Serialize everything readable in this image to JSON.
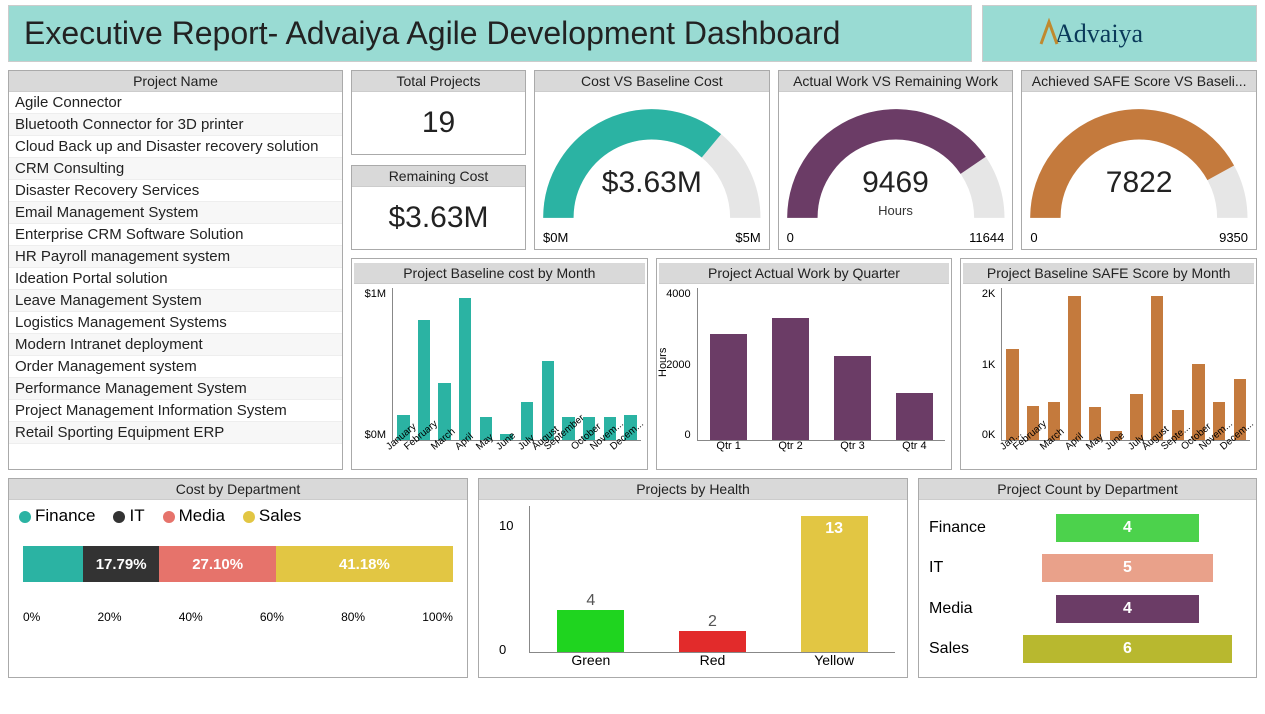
{
  "header": {
    "title": "Executive Report- Advaiya Agile Development Dashboard",
    "logo_text": "Advaiya"
  },
  "project_list": {
    "title": "Project Name",
    "items": [
      "Agile Connector",
      "Bluetooth Connector for 3D printer",
      "Cloud Back up and Disaster recovery solution",
      "CRM Consulting",
      "Disaster Recovery Services",
      "Email Management System",
      "Enterprise CRM Software Solution",
      "HR Payroll management system",
      "Ideation Portal solution",
      "Leave Management System",
      "Logistics Management Systems",
      "Modern Intranet deployment",
      "Order Management system",
      "Performance Management System",
      "Project Management Information System",
      "Retail Sporting Equipment ERP"
    ]
  },
  "kpis": {
    "total_projects": {
      "title": "Total Projects",
      "value": "19"
    },
    "remaining_cost": {
      "title": "Remaining Cost",
      "value": "$3.63M"
    }
  },
  "gauges": {
    "cost": {
      "title": "Cost VS Baseline Cost",
      "value": "$3.63M",
      "min": "$0M",
      "max": "$5M",
      "color": "#2bb3a3",
      "fill_pct": 72
    },
    "work": {
      "title": "Actual Work VS Remaining Work",
      "value": "9469",
      "sub": "Hours",
      "min": "0",
      "max": "11644",
      "color": "#6b3c66",
      "fill_pct": 81
    },
    "safe": {
      "title": "Achieved SAFE Score VS Baseli...",
      "value": "7822",
      "min": "0",
      "max": "9350",
      "color": "#c47a3d",
      "fill_pct": 84
    }
  },
  "chart_data": [
    {
      "type": "bar",
      "name": "baseline_cost_month",
      "title": "Project Baseline cost by Month",
      "categories": [
        "January",
        "February",
        "March",
        "April",
        "May",
        "June",
        "July",
        "August",
        "September",
        "October",
        "Novem...",
        "Decem..."
      ],
      "values": [
        0.2,
        0.95,
        0.45,
        1.12,
        0.18,
        0.05,
        0.3,
        0.62,
        0.18,
        0.18,
        0.18,
        0.2
      ],
      "ylabel": "",
      "ylim": [
        0,
        1.2
      ],
      "yticks": [
        "$1M",
        "$0M"
      ],
      "color": "#2bb3a3"
    },
    {
      "type": "bar",
      "name": "actual_work_quarter",
      "title": "Project Actual Work by Quarter",
      "categories": [
        "Qtr 1",
        "Qtr 2",
        "Qtr 3",
        "Qtr 4"
      ],
      "values": [
        2800,
        3200,
        2200,
        1250
      ],
      "ylabel": "Hours",
      "ylim": [
        0,
        4000
      ],
      "yticks": [
        "4000",
        "2000",
        "0"
      ],
      "color": "#6b3c66"
    },
    {
      "type": "bar",
      "name": "safe_score_month",
      "title": "Project Baseline SAFE Score by Month",
      "categories": [
        "Jan...",
        "February",
        "March",
        "April",
        "May",
        "June",
        "July",
        "August",
        "Septe...",
        "October",
        "Novem...",
        "Decem..."
      ],
      "values": [
        1200,
        450,
        500,
        1900,
        430,
        120,
        600,
        1900,
        400,
        1000,
        500,
        800
      ],
      "ylabel": "",
      "ylim": [
        0,
        2000
      ],
      "yticks": [
        "2K",
        "1K",
        "0K"
      ],
      "color": "#c47a3d"
    },
    {
      "type": "bar",
      "name": "cost_by_department",
      "title": "Cost by Department",
      "legend": [
        "Finance",
        "IT",
        "Media",
        "Sales"
      ],
      "colors": {
        "Finance": "#2bb3a3",
        "IT": "#333333",
        "Media": "#e6736b",
        "Sales": "#e2c643"
      },
      "segments": [
        {
          "name": "Finance",
          "pct": 13.93,
          "label": ""
        },
        {
          "name": "IT",
          "pct": 17.79,
          "label": "17.79%"
        },
        {
          "name": "Media",
          "pct": 27.1,
          "label": "27.10%"
        },
        {
          "name": "Sales",
          "pct": 41.18,
          "label": "41.18%"
        }
      ],
      "axis": [
        "0%",
        "20%",
        "40%",
        "60%",
        "80%",
        "100%"
      ]
    },
    {
      "type": "bar",
      "name": "projects_by_health",
      "title": "Projects by Health",
      "categories": [
        "Green",
        "Red",
        "Yellow"
      ],
      "values": [
        4,
        2,
        13
      ],
      "colors": [
        "#1fd41f",
        "#e22b2b",
        "#e2c643"
      ],
      "ylim": [
        0,
        14
      ],
      "yticks": [
        "10",
        "0"
      ]
    },
    {
      "type": "bar",
      "name": "project_count_department",
      "title": "Project Count by Department",
      "rows": [
        {
          "label": "Finance",
          "value": 4,
          "color": "#4cd24c",
          "width": 60
        },
        {
          "label": "IT",
          "value": 5,
          "color": "#e9a18a",
          "width": 72
        },
        {
          "label": "Media",
          "value": 4,
          "color": "#6b3c66",
          "width": 60
        },
        {
          "label": "Sales",
          "value": 6,
          "color": "#b8b82f",
          "width": 88
        }
      ]
    }
  ]
}
